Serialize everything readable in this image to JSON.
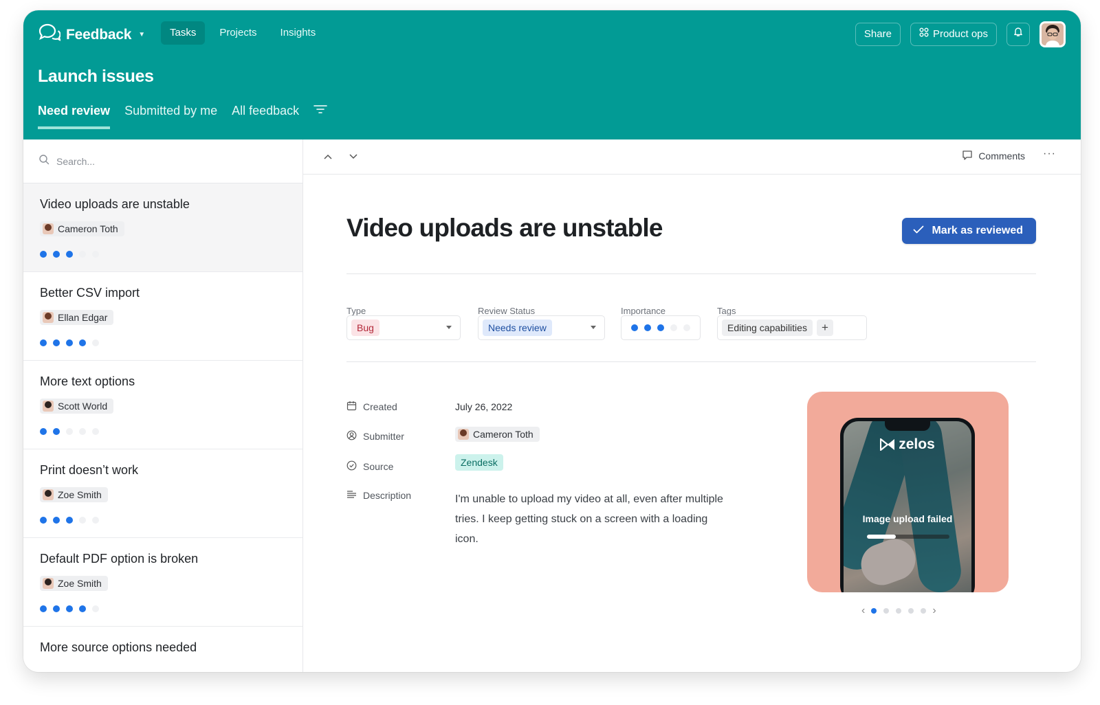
{
  "app": {
    "name": "Feedback"
  },
  "nav": [
    {
      "label": "Tasks",
      "active": true
    },
    {
      "label": "Projects",
      "active": false
    },
    {
      "label": "Insights",
      "active": false
    }
  ],
  "header_actions": {
    "share": "Share",
    "product_ops": "Product ops"
  },
  "page": {
    "title": "Launch issues"
  },
  "tabs": [
    {
      "label": "Need review",
      "active": true
    },
    {
      "label": "Submitted by me",
      "active": false
    },
    {
      "label": "All feedback",
      "active": false
    }
  ],
  "search": {
    "placeholder": "Search..."
  },
  "feedback_items": [
    {
      "title": "Video uploads are unstable",
      "submitter": "Cameron Toth",
      "importance": 3,
      "selected": true
    },
    {
      "title": "Better CSV import",
      "submitter": "Ellan Edgar",
      "importance": 4,
      "selected": false
    },
    {
      "title": "More text options",
      "submitter": "Scott World",
      "importance": 2,
      "selected": false
    },
    {
      "title": "Print doesn’t work",
      "submitter": "Zoe Smith",
      "importance": 3,
      "selected": false
    },
    {
      "title": "Default PDF option is broken",
      "submitter": "Zoe Smith",
      "importance": 4,
      "selected": false
    },
    {
      "title": "More source options needed",
      "submitter": "",
      "importance": 0,
      "selected": false
    }
  ],
  "toolbar": {
    "comments": "Comments"
  },
  "detail": {
    "title": "Video uploads are unstable",
    "mark_button": "Mark as reviewed",
    "fields": {
      "type": {
        "label": "Type",
        "value": "Bug"
      },
      "review_status": {
        "label": "Review Status",
        "value": "Needs review"
      },
      "importance": {
        "label": "Importance",
        "value": 3,
        "max": 5
      },
      "tags": {
        "label": "Tags",
        "values": [
          "Editing capabilities"
        ],
        "add": "+"
      }
    },
    "meta": {
      "created": {
        "label": "Created",
        "value": "July 26, 2022"
      },
      "submitter": {
        "label": "Submitter",
        "value": "Cameron Toth"
      },
      "source": {
        "label": "Source",
        "value": "Zendesk"
      },
      "description": {
        "label": "Description",
        "value": "I'm unable to upload my video at all, even after multiple tries. I keep getting stuck on a screen with a loading icon."
      }
    },
    "attachment": {
      "brand": "zelos",
      "message": "Image upload failed",
      "progress": 0.35,
      "carousel_count": 5,
      "carousel_active": 1
    }
  },
  "colors": {
    "header": "#029b95",
    "accent": "#2b5fbb",
    "dot_on": "#1f74e8"
  }
}
